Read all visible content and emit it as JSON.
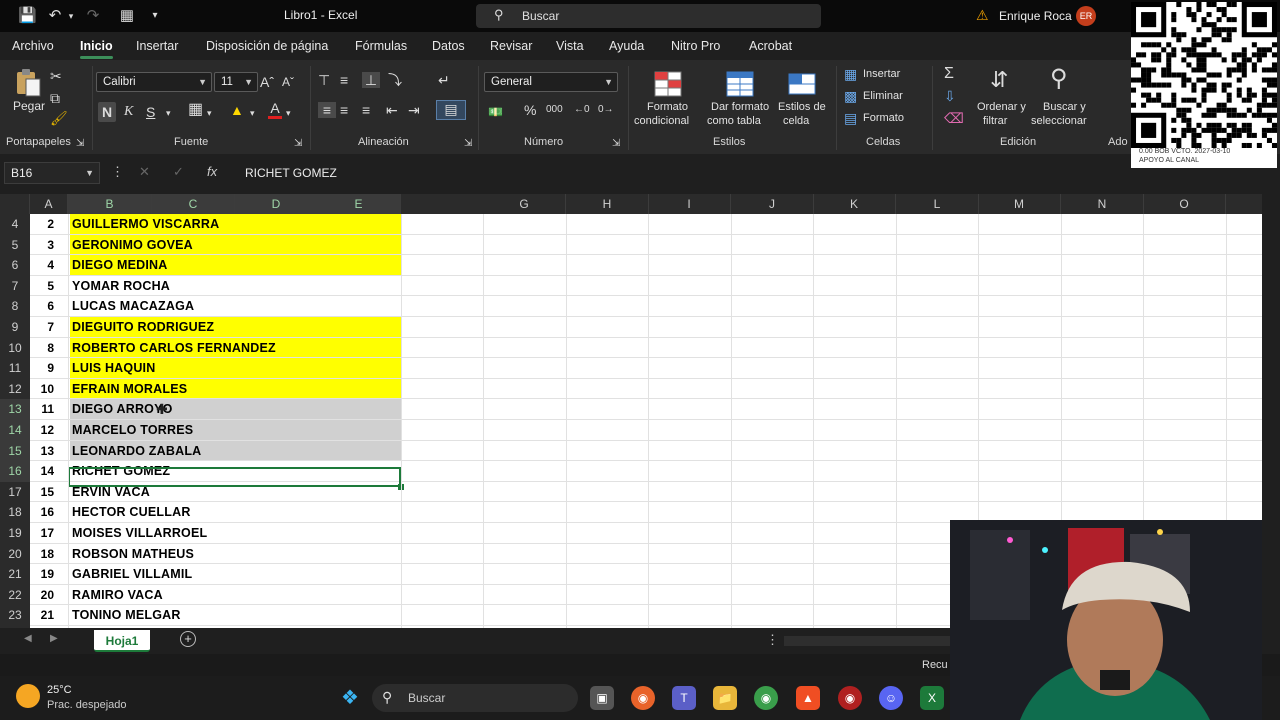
{
  "titlebar": {
    "title": "Libro1  -  Excel",
    "search_label": "Buscar",
    "user_name": "Enrique Roca",
    "user_initials": "ER"
  },
  "menu": [
    "Archivo",
    "Inicio",
    "Insertar",
    "Disposición de página",
    "Fórmulas",
    "Datos",
    "Revisar",
    "Vista",
    "Ayuda",
    "Nitro Pro",
    "Acrobat"
  ],
  "ribbon": {
    "paste_label": "Pegar",
    "font_name": "Calibri",
    "font_size": "11",
    "number_format": "General",
    "cond_format": [
      "Formato",
      "condicional"
    ],
    "table_format": [
      "Dar formato",
      "como tabla"
    ],
    "cell_styles": [
      "Estilos de",
      "celda"
    ],
    "insert": "Insertar",
    "delete": "Eliminar",
    "format": "Formato",
    "sort_filter": [
      "Ordenar y",
      "filtrar"
    ],
    "find_select": [
      "Buscar y",
      "seleccionar"
    ],
    "groups": [
      "Portapapeles",
      "Fuente",
      "Alineación",
      "Número",
      "Estilos",
      "Celdas",
      "Edición",
      "Ado"
    ]
  },
  "formula": {
    "namebox": "B16",
    "fx": "fx",
    "value": "RICHET GOMEZ"
  },
  "columns": [
    "A",
    "B",
    "C",
    "D",
    "E",
    "G",
    "H",
    "I",
    "J",
    "K",
    "L",
    "M",
    "N",
    "O",
    "P"
  ],
  "rows": [
    {
      "row": "4",
      "num": "2",
      "name": "GUILLERMO VISCARRA",
      "fill": "yellow"
    },
    {
      "row": "5",
      "num": "3",
      "name": "GERONIMO GOVEA",
      "fill": "yellow"
    },
    {
      "row": "6",
      "num": "4",
      "name": "DIEGO MEDINA",
      "fill": "yellow"
    },
    {
      "row": "7",
      "num": "5",
      "name": "YOMAR ROCHA",
      "fill": ""
    },
    {
      "row": "8",
      "num": "6",
      "name": "LUCAS MACAZAGA",
      "fill": ""
    },
    {
      "row": "9",
      "num": "7",
      "name": "DIEGUITO RODRIGUEZ",
      "fill": "yellow"
    },
    {
      "row": "10",
      "num": "8",
      "name": "ROBERTO CARLOS FERNANDEZ",
      "fill": "yellow"
    },
    {
      "row": "11",
      "num": "9",
      "name": "LUIS HAQUIN",
      "fill": "yellow"
    },
    {
      "row": "12",
      "num": "10",
      "name": "EFRAIN MORALES",
      "fill": "yellow"
    },
    {
      "row": "13",
      "num": "11",
      "name": "DIEGO ARROYO",
      "fill": "shaded"
    },
    {
      "row": "14",
      "num": "12",
      "name": "MARCELO TORRES",
      "fill": "shaded"
    },
    {
      "row": "15",
      "num": "13",
      "name": "LEONARDO ZABALA",
      "fill": "shaded"
    },
    {
      "row": "16",
      "num": "14",
      "name": "RICHET GOMEZ",
      "fill": "active"
    },
    {
      "row": "17",
      "num": "15",
      "name": "ERVIN VACA",
      "fill": ""
    },
    {
      "row": "18",
      "num": "16",
      "name": "HECTOR CUELLAR",
      "fill": ""
    },
    {
      "row": "19",
      "num": "17",
      "name": "MOISES VILLARROEL",
      "fill": ""
    },
    {
      "row": "20",
      "num": "18",
      "name": "ROBSON MATHEUS",
      "fill": ""
    },
    {
      "row": "21",
      "num": "19",
      "name": "GABRIEL VILLAMIL",
      "fill": ""
    },
    {
      "row": "22",
      "num": "20",
      "name": "RAMIRO VACA",
      "fill": ""
    },
    {
      "row": "23",
      "num": "21",
      "name": "TONINO MELGAR",
      "fill": ""
    }
  ],
  "sheet": {
    "tab": "Hoja1"
  },
  "status": {
    "right_text": "Recu"
  },
  "weather": {
    "temp": "25°C",
    "desc": "Prac. despejado"
  },
  "taskbar": {
    "search_label": "Buscar"
  },
  "qr": {
    "caption_1": "0.00 BOB  VCTO. 2027-03-10",
    "caption_2": "APOYO AL CANAL"
  },
  "colors": {
    "accent": "#1d7a3a",
    "highlight": "#ffff00",
    "selection_shade": "#d0d0d0"
  }
}
